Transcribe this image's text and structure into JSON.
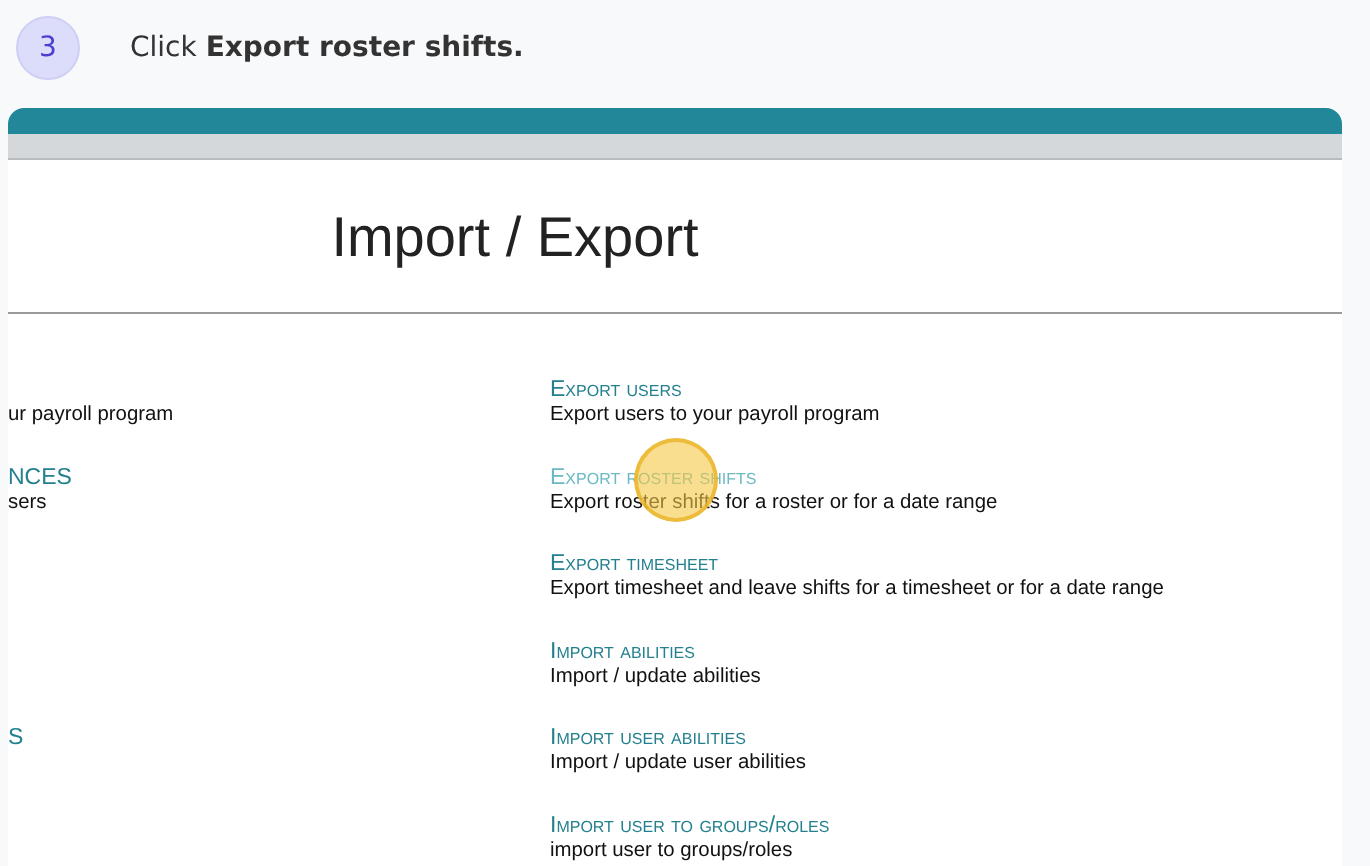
{
  "step": {
    "number": "3",
    "instruction": "Click **Export roster shifts.**"
  },
  "page": {
    "heading": "Import / Export",
    "rows": [
      {
        "left": {
          "description": "ur payroll program"
        },
        "right": {
          "title": "Export users",
          "description": "Export users to your payroll program",
          "hovered": false
        }
      },
      {
        "left": {
          "title": "NCES",
          "description": "sers"
        },
        "right": {
          "title": "Export roster shifts",
          "description": "Export roster shifts for a roster or for a date range",
          "hovered": true
        }
      },
      {
        "right": {
          "title": "Export timesheet",
          "description": "Export timesheet and leave shifts for a timesheet or for a date range",
          "hovered": false
        }
      },
      {
        "right": {
          "title": "Import abilities",
          "description": "Import / update abilities",
          "hovered": false
        }
      },
      {
        "left": {
          "title": "S"
        },
        "right": {
          "title": "Import user abilities",
          "description": "Import / update user abilities",
          "hovered": false
        }
      },
      {
        "right": {
          "title": "Import user to groups/roles",
          "description": "import user to groups/roles",
          "hovered": false
        }
      }
    ]
  }
}
